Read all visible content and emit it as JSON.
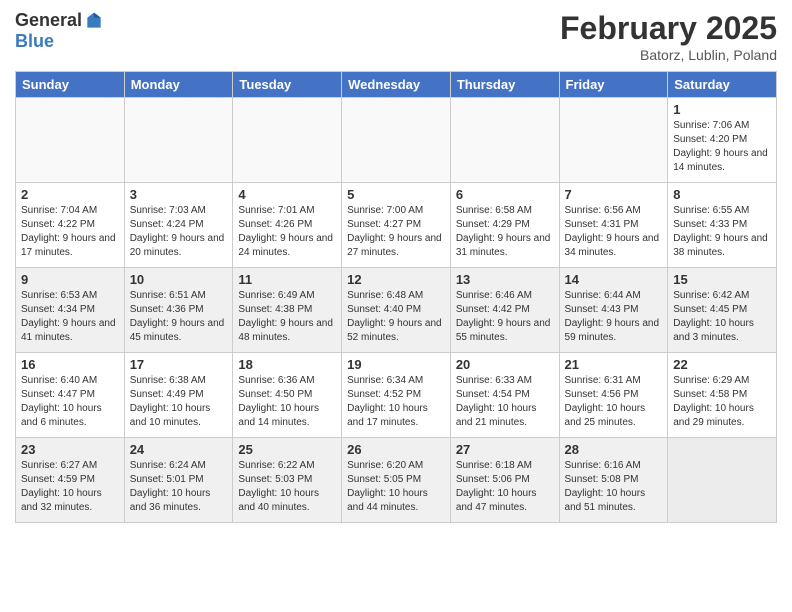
{
  "header": {
    "logo_general": "General",
    "logo_blue": "Blue",
    "title": "February 2025",
    "location": "Batorz, Lublin, Poland"
  },
  "days_of_week": [
    "Sunday",
    "Monday",
    "Tuesday",
    "Wednesday",
    "Thursday",
    "Friday",
    "Saturday"
  ],
  "weeks": [
    {
      "shaded": false,
      "days": [
        {
          "num": "",
          "info": ""
        },
        {
          "num": "",
          "info": ""
        },
        {
          "num": "",
          "info": ""
        },
        {
          "num": "",
          "info": ""
        },
        {
          "num": "",
          "info": ""
        },
        {
          "num": "",
          "info": ""
        },
        {
          "num": "1",
          "info": "Sunrise: 7:06 AM\nSunset: 4:20 PM\nDaylight: 9 hours and 14 minutes."
        }
      ]
    },
    {
      "shaded": false,
      "days": [
        {
          "num": "2",
          "info": "Sunrise: 7:04 AM\nSunset: 4:22 PM\nDaylight: 9 hours and 17 minutes."
        },
        {
          "num": "3",
          "info": "Sunrise: 7:03 AM\nSunset: 4:24 PM\nDaylight: 9 hours and 20 minutes."
        },
        {
          "num": "4",
          "info": "Sunrise: 7:01 AM\nSunset: 4:26 PM\nDaylight: 9 hours and 24 minutes."
        },
        {
          "num": "5",
          "info": "Sunrise: 7:00 AM\nSunset: 4:27 PM\nDaylight: 9 hours and 27 minutes."
        },
        {
          "num": "6",
          "info": "Sunrise: 6:58 AM\nSunset: 4:29 PM\nDaylight: 9 hours and 31 minutes."
        },
        {
          "num": "7",
          "info": "Sunrise: 6:56 AM\nSunset: 4:31 PM\nDaylight: 9 hours and 34 minutes."
        },
        {
          "num": "8",
          "info": "Sunrise: 6:55 AM\nSunset: 4:33 PM\nDaylight: 9 hours and 38 minutes."
        }
      ]
    },
    {
      "shaded": true,
      "days": [
        {
          "num": "9",
          "info": "Sunrise: 6:53 AM\nSunset: 4:34 PM\nDaylight: 9 hours and 41 minutes."
        },
        {
          "num": "10",
          "info": "Sunrise: 6:51 AM\nSunset: 4:36 PM\nDaylight: 9 hours and 45 minutes."
        },
        {
          "num": "11",
          "info": "Sunrise: 6:49 AM\nSunset: 4:38 PM\nDaylight: 9 hours and 48 minutes."
        },
        {
          "num": "12",
          "info": "Sunrise: 6:48 AM\nSunset: 4:40 PM\nDaylight: 9 hours and 52 minutes."
        },
        {
          "num": "13",
          "info": "Sunrise: 6:46 AM\nSunset: 4:42 PM\nDaylight: 9 hours and 55 minutes."
        },
        {
          "num": "14",
          "info": "Sunrise: 6:44 AM\nSunset: 4:43 PM\nDaylight: 9 hours and 59 minutes."
        },
        {
          "num": "15",
          "info": "Sunrise: 6:42 AM\nSunset: 4:45 PM\nDaylight: 10 hours and 3 minutes."
        }
      ]
    },
    {
      "shaded": false,
      "days": [
        {
          "num": "16",
          "info": "Sunrise: 6:40 AM\nSunset: 4:47 PM\nDaylight: 10 hours and 6 minutes."
        },
        {
          "num": "17",
          "info": "Sunrise: 6:38 AM\nSunset: 4:49 PM\nDaylight: 10 hours and 10 minutes."
        },
        {
          "num": "18",
          "info": "Sunrise: 6:36 AM\nSunset: 4:50 PM\nDaylight: 10 hours and 14 minutes."
        },
        {
          "num": "19",
          "info": "Sunrise: 6:34 AM\nSunset: 4:52 PM\nDaylight: 10 hours and 17 minutes."
        },
        {
          "num": "20",
          "info": "Sunrise: 6:33 AM\nSunset: 4:54 PM\nDaylight: 10 hours and 21 minutes."
        },
        {
          "num": "21",
          "info": "Sunrise: 6:31 AM\nSunset: 4:56 PM\nDaylight: 10 hours and 25 minutes."
        },
        {
          "num": "22",
          "info": "Sunrise: 6:29 AM\nSunset: 4:58 PM\nDaylight: 10 hours and 29 minutes."
        }
      ]
    },
    {
      "shaded": true,
      "days": [
        {
          "num": "23",
          "info": "Sunrise: 6:27 AM\nSunset: 4:59 PM\nDaylight: 10 hours and 32 minutes."
        },
        {
          "num": "24",
          "info": "Sunrise: 6:24 AM\nSunset: 5:01 PM\nDaylight: 10 hours and 36 minutes."
        },
        {
          "num": "25",
          "info": "Sunrise: 6:22 AM\nSunset: 5:03 PM\nDaylight: 10 hours and 40 minutes."
        },
        {
          "num": "26",
          "info": "Sunrise: 6:20 AM\nSunset: 5:05 PM\nDaylight: 10 hours and 44 minutes."
        },
        {
          "num": "27",
          "info": "Sunrise: 6:18 AM\nSunset: 5:06 PM\nDaylight: 10 hours and 47 minutes."
        },
        {
          "num": "28",
          "info": "Sunrise: 6:16 AM\nSunset: 5:08 PM\nDaylight: 10 hours and 51 minutes."
        },
        {
          "num": "",
          "info": ""
        }
      ]
    }
  ]
}
